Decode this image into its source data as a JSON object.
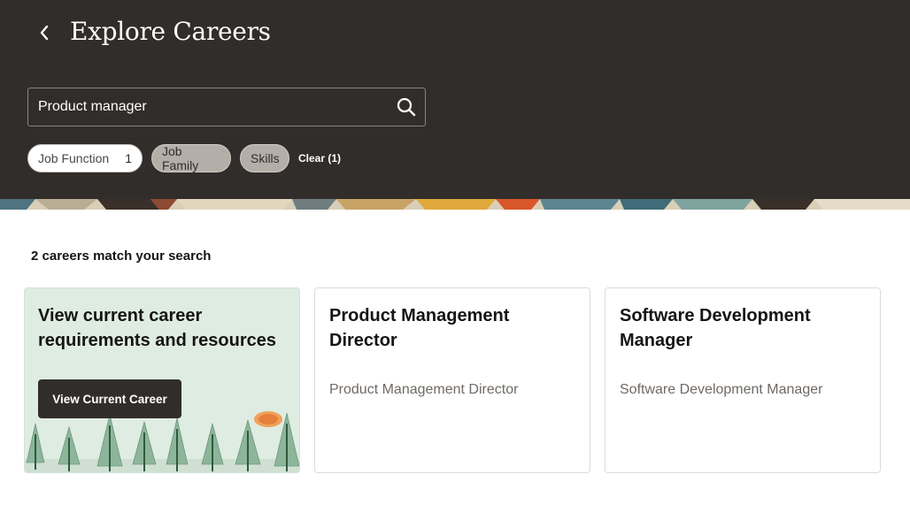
{
  "header": {
    "title": "Explore Careers",
    "back_icon": "chevron-left-icon"
  },
  "search": {
    "value": "Product manager",
    "icon": "search-icon"
  },
  "filters": [
    {
      "label": "Job Function",
      "count": "1"
    },
    {
      "label": "Job Family"
    },
    {
      "label": "Skills"
    }
  ],
  "clear_label": "Clear (1)",
  "results": {
    "summary": "2 careers match your search"
  },
  "promo": {
    "title": "View current career requirements and resources",
    "button_label": "View Current Career"
  },
  "cards": [
    {
      "title": "Product Management Director",
      "subtitle": "Product Management Director"
    },
    {
      "title": "Software Development Manager",
      "subtitle": "Software Development Manager"
    }
  ],
  "colors": {
    "header_bg": "#312d2a",
    "promo_bg": "#dfece2",
    "tree_green": "#7aa88a"
  }
}
